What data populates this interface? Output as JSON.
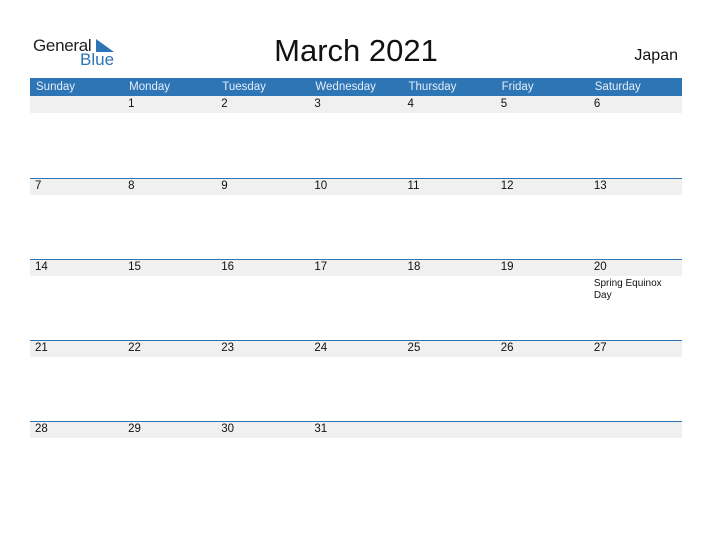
{
  "logo": {
    "general": "General",
    "blue": "Blue",
    "accent": "#2e75b6"
  },
  "title": "March 2021",
  "country": "Japan",
  "weekdays": [
    "Sunday",
    "Monday",
    "Tuesday",
    "Wednesday",
    "Thursday",
    "Friday",
    "Saturday"
  ],
  "weeks": [
    [
      {
        "day": ""
      },
      {
        "day": "1"
      },
      {
        "day": "2"
      },
      {
        "day": "3"
      },
      {
        "day": "4"
      },
      {
        "day": "5"
      },
      {
        "day": "6"
      }
    ],
    [
      {
        "day": "7"
      },
      {
        "day": "8"
      },
      {
        "day": "9"
      },
      {
        "day": "10"
      },
      {
        "day": "11"
      },
      {
        "day": "12"
      },
      {
        "day": "13"
      }
    ],
    [
      {
        "day": "14"
      },
      {
        "day": "15"
      },
      {
        "day": "16"
      },
      {
        "day": "17"
      },
      {
        "day": "18"
      },
      {
        "day": "19"
      },
      {
        "day": "20",
        "event": "Spring Equinox Day"
      }
    ],
    [
      {
        "day": "21"
      },
      {
        "day": "22"
      },
      {
        "day": "23"
      },
      {
        "day": "24"
      },
      {
        "day": "25"
      },
      {
        "day": "26"
      },
      {
        "day": "27"
      }
    ],
    [
      {
        "day": "28"
      },
      {
        "day": "29"
      },
      {
        "day": "30"
      },
      {
        "day": "31"
      },
      {
        "day": ""
      },
      {
        "day": ""
      },
      {
        "day": ""
      }
    ]
  ]
}
